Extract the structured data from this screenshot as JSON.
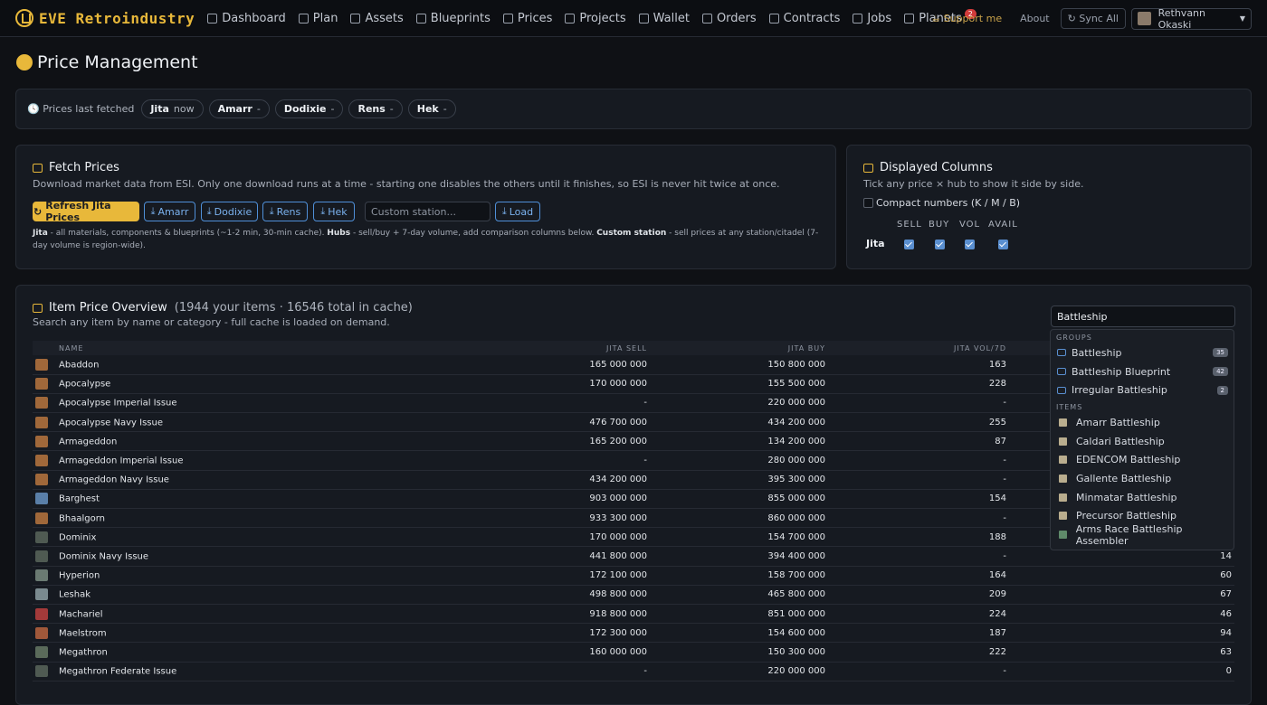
{
  "nav": {
    "brand": "EVE Retroindustry",
    "links": [
      "Dashboard",
      "Plan",
      "Assets",
      "Blueprints",
      "Prices",
      "Projects",
      "Wallet",
      "Orders",
      "Contracts",
      "Jobs",
      "Planets"
    ],
    "planets_badge": "2",
    "support": "Support me",
    "about": "About",
    "sync": "Sync All",
    "user": "Rethvann Okaski"
  },
  "page_title": "Price Management",
  "fetched": {
    "label": "Prices last fetched",
    "hubs": [
      {
        "name": "Jita",
        "value": "now"
      },
      {
        "name": "Amarr",
        "value": "-"
      },
      {
        "name": "Dodixie",
        "value": "-"
      },
      {
        "name": "Rens",
        "value": "-"
      },
      {
        "name": "Hek",
        "value": "-"
      }
    ]
  },
  "fetch": {
    "title": "Fetch Prices",
    "desc": "Download market data from ESI. Only one download runs at a time - starting one disables the others until it finishes, so ESI is never hit twice at once.",
    "refresh": "Refresh Jita Prices",
    "hub_buttons": [
      "Amarr",
      "Dodixie",
      "Rens",
      "Hek"
    ],
    "station_placeholder": "Custom station...",
    "load": "Load",
    "note_b1": "Jita",
    "note_t1": " - all materials, components & blueprints (~1-2 min, 30-min cache). ",
    "note_b2": "Hubs",
    "note_t2": " - sell/buy + 7-day volume, add comparison columns below. ",
    "note_b3": "Custom station",
    "note_t3": " - sell prices at any station/citadel (7-day volume is region-wide)."
  },
  "columns": {
    "title": "Displayed Columns",
    "desc": "Tick any price × hub to show it side by side.",
    "compact": "Compact numbers (K / M / B)",
    "headers": [
      "SELL",
      "BUY",
      "VOL",
      "AVAIL"
    ],
    "row": "Jita"
  },
  "overview": {
    "title": "Item Price Overview",
    "count": "(1944 your items · 16546 total in cache)",
    "desc": "Search any item by name or category - full cache is loaded on demand.",
    "search_value": "Battleship",
    "headers": [
      "NAME",
      "JITA SELL",
      "JITA BUY",
      "JITA VOL/7D"
    ],
    "rows": [
      [
        "Abaddon",
        "165 000 000",
        "150 800 000",
        "163",
        ""
      ],
      [
        "Apocalypse",
        "170 000 000",
        "155 500 000",
        "228",
        ""
      ],
      [
        "Apocalypse Imperial Issue",
        "-",
        "220 000 000",
        "-",
        ""
      ],
      [
        "Apocalypse Navy Issue",
        "476 700 000",
        "434 200 000",
        "255",
        ""
      ],
      [
        "Armageddon",
        "165 200 000",
        "134 200 000",
        "87",
        ""
      ],
      [
        "Armageddon Imperial Issue",
        "-",
        "280 000 000",
        "-",
        ""
      ],
      [
        "Armageddon Navy Issue",
        "434 200 000",
        "395 300 000",
        "-",
        ""
      ],
      [
        "Barghest",
        "903 000 000",
        "855 000 000",
        "154",
        ""
      ],
      [
        "Bhaalgorn",
        "933 300 000",
        "860 000 000",
        "-",
        ""
      ],
      [
        "Dominix",
        "170 000 000",
        "154 700 000",
        "188",
        ""
      ],
      [
        "Dominix Navy Issue",
        "441 800 000",
        "394 400 000",
        "-",
        "14"
      ],
      [
        "Hyperion",
        "172 100 000",
        "158 700 000",
        "164",
        "60"
      ],
      [
        "Leshak",
        "498 800 000",
        "465 800 000",
        "209",
        "67"
      ],
      [
        "Machariel",
        "918 800 000",
        "851 000 000",
        "224",
        "46"
      ],
      [
        "Maelstrom",
        "172 300 000",
        "154 600 000",
        "187",
        "94"
      ],
      [
        "Megathron",
        "160 000 000",
        "150 300 000",
        "222",
        "63"
      ],
      [
        "Megathron Federate Issue",
        "-",
        "220 000 000",
        "-",
        "0"
      ]
    ],
    "ship_colors": [
      "#a0683a",
      "#a0683a",
      "#a0683a",
      "#a0683a",
      "#a0683a",
      "#a0683a",
      "#a0683a",
      "#5a7fa8",
      "#a0683a",
      "#4f5a52",
      "#4f5a52",
      "#6a7a72",
      "#7a8a8f",
      "#a33a3a",
      "#a0583a",
      "#5a6a5a",
      "#4f5a52"
    ],
    "dropdown": {
      "groups_label": "GROUPS",
      "groups": [
        {
          "name": "Battleship",
          "count": "35"
        },
        {
          "name": "Battleship Blueprint",
          "count": "42"
        },
        {
          "name": "Irregular Battleship",
          "count": "2"
        }
      ],
      "items_label": "ITEMS",
      "items": [
        "Amarr Battleship",
        "Caldari Battleship",
        "EDENCOM Battleship",
        "Gallente Battleship",
        "Minmatar Battleship",
        "Precursor Battleship",
        "Arms Race Battleship Assembler"
      ]
    }
  }
}
